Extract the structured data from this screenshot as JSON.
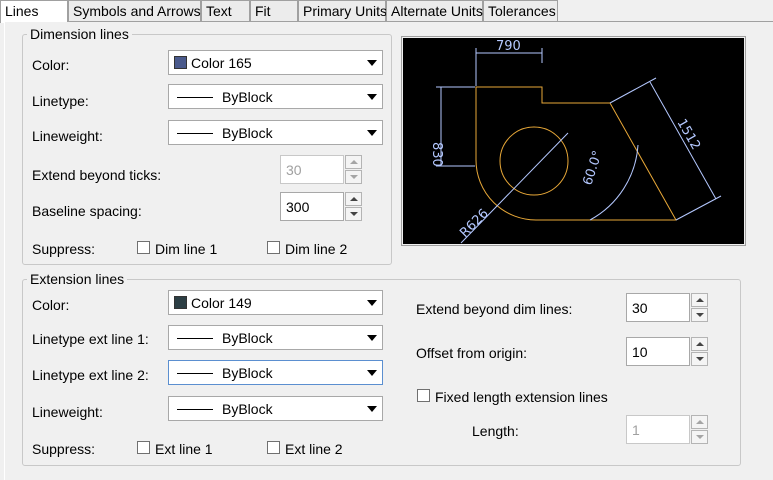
{
  "tabs": [
    {
      "label": "Lines",
      "active": true
    },
    {
      "label": "Symbols and Arrows"
    },
    {
      "label": "Text"
    },
    {
      "label": "Fit"
    },
    {
      "label": "Primary Units"
    },
    {
      "label": "Alternate Units"
    },
    {
      "label": "Tolerances"
    }
  ],
  "dimension_lines": {
    "title": "Dimension lines",
    "color_label": "Color:",
    "color_value": "Color 165",
    "color_swatch": "#4a5a8c",
    "linetype_label": "Linetype:",
    "linetype_value": "ByBlock",
    "lineweight_label": "Lineweight:",
    "lineweight_value": "ByBlock",
    "extend_label": "Extend beyond ticks:",
    "extend_value": "30",
    "baseline_label": "Baseline spacing:",
    "baseline_value": "300",
    "suppress_label": "Suppress:",
    "dim_line1": "Dim line 1",
    "dim_line2": "Dim line 2"
  },
  "preview": {
    "dim_790": "790",
    "dim_830": "830",
    "dim_1512": "1512",
    "dim_angle": "60.0°",
    "dim_radius": "R626",
    "geom_color": "#e8a838",
    "dim_color": "#b4c8ff"
  },
  "extension_lines": {
    "title": "Extension lines",
    "color_label": "Color:",
    "color_value": "Color 149",
    "color_swatch": "#2c3e44",
    "linetype1_label": "Linetype ext line 1:",
    "linetype1_value": "ByBlock",
    "linetype2_label": "Linetype ext line 2:",
    "linetype2_value": "ByBlock",
    "lineweight_label": "Lineweight:",
    "lineweight_value": "ByBlock",
    "suppress_label": "Suppress:",
    "ext_line1": "Ext line 1",
    "ext_line2": "Ext line 2",
    "extend_dim_label": "Extend beyond dim lines:",
    "extend_dim_value": "30",
    "offset_label": "Offset from origin:",
    "offset_value": "10",
    "fixed_length_label": "Fixed length extension lines",
    "length_label": "Length:",
    "length_value": "1"
  }
}
